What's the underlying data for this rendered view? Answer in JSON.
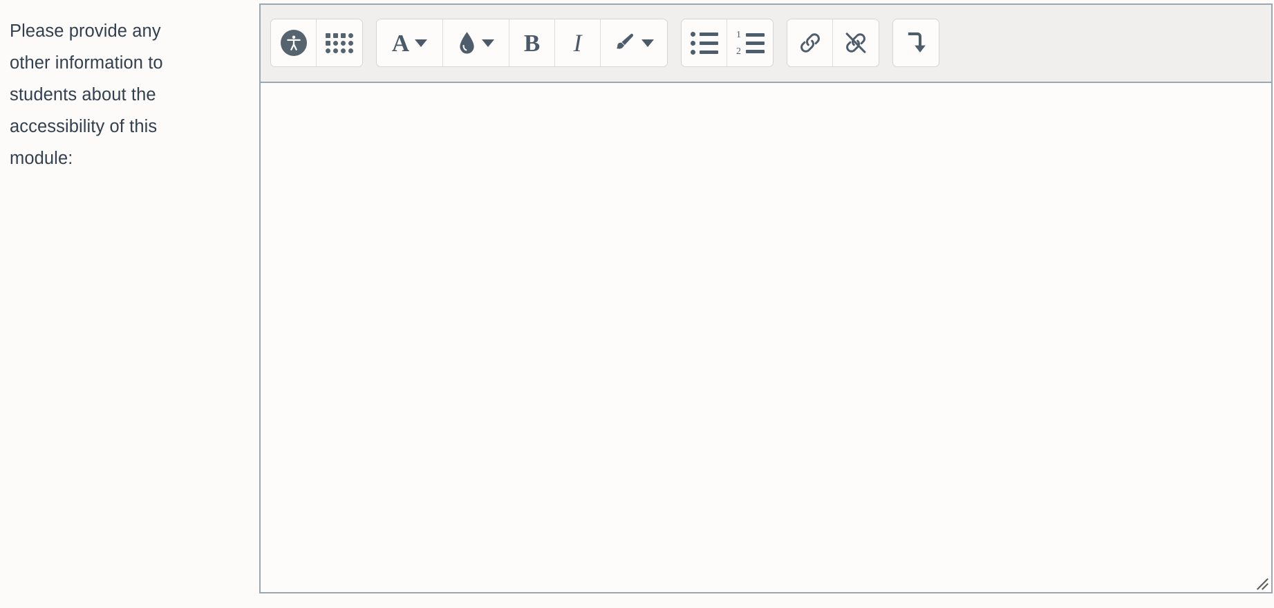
{
  "field": {
    "label": "Please provide any other information to students about the accessibility of this module:",
    "label_lines": [
      "Please provide any",
      "other information to",
      "students about the",
      "accessibility of this",
      "module:"
    ]
  },
  "editor": {
    "name": "rich-text-editor",
    "content": "",
    "placeholder": "",
    "border_color": "#9aa7b2",
    "toolbar_background": "#f0efee",
    "surface_background": "#fdfcfa",
    "icon_color": "#4e5d6c",
    "text_color": "#32404f",
    "resize_handle": "resize-grip"
  },
  "toolbar": {
    "groups": [
      {
        "name": "accessibility-group",
        "buttons": [
          {
            "name": "accessibility-checker-button",
            "icon": "accessibility-icon",
            "label": "Accessibility checker",
            "has_caret": false
          },
          {
            "name": "special-characters-button",
            "icon": "dot-grid-icon",
            "label": "Insert character",
            "has_caret": false
          }
        ]
      },
      {
        "name": "text-formatting-group",
        "buttons": [
          {
            "name": "font-color-button",
            "icon": "letter-a-icon",
            "label": "A",
            "has_caret": true
          },
          {
            "name": "background-color-button",
            "icon": "droplet-icon",
            "label": "Background colour",
            "has_caret": true
          },
          {
            "name": "bold-button",
            "icon": "letter-b-icon",
            "label": "B",
            "has_caret": false
          },
          {
            "name": "italic-button",
            "icon": "letter-i-icon",
            "label": "I",
            "has_caret": false
          },
          {
            "name": "style-brush-button",
            "icon": "paint-brush-icon",
            "label": "Styles",
            "has_caret": true
          }
        ]
      },
      {
        "name": "list-group",
        "buttons": [
          {
            "name": "bulleted-list-button",
            "icon": "bulleted-list-icon",
            "label": "Unordered list",
            "has_caret": false
          },
          {
            "name": "numbered-list-button",
            "icon": "numbered-list-icon",
            "label": "Ordered list",
            "has_caret": false
          }
        ]
      },
      {
        "name": "link-group",
        "buttons": [
          {
            "name": "insert-link-button",
            "icon": "link-icon",
            "label": "Link",
            "has_caret": false
          },
          {
            "name": "unlink-button",
            "icon": "unlink-icon",
            "label": "Unlink",
            "has_caret": false
          }
        ]
      },
      {
        "name": "expand-group",
        "buttons": [
          {
            "name": "show-more-buttons-button",
            "icon": "arrow-turn-down-icon",
            "label": "Show more buttons",
            "has_caret": false
          }
        ]
      }
    ]
  },
  "numbered_list_digits": [
    "1",
    "2"
  ]
}
